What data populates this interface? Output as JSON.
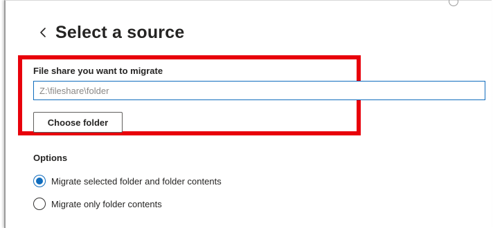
{
  "page": {
    "title": "Select a source",
    "back_icon": "chevron-left-icon"
  },
  "source": {
    "field_label": "File share you want to migrate",
    "input_value": "",
    "input_placeholder": "Z:\\fileshare\\folder",
    "choose_button_label": "Choose folder"
  },
  "options": {
    "label": "Options",
    "items": [
      {
        "label": "Migrate selected folder and folder contents",
        "selected": true
      },
      {
        "label": "Migrate only folder contents",
        "selected": false
      }
    ]
  },
  "colors": {
    "accent": "#0f6cbd",
    "highlight": "#e8000b",
    "text": "#252423"
  }
}
